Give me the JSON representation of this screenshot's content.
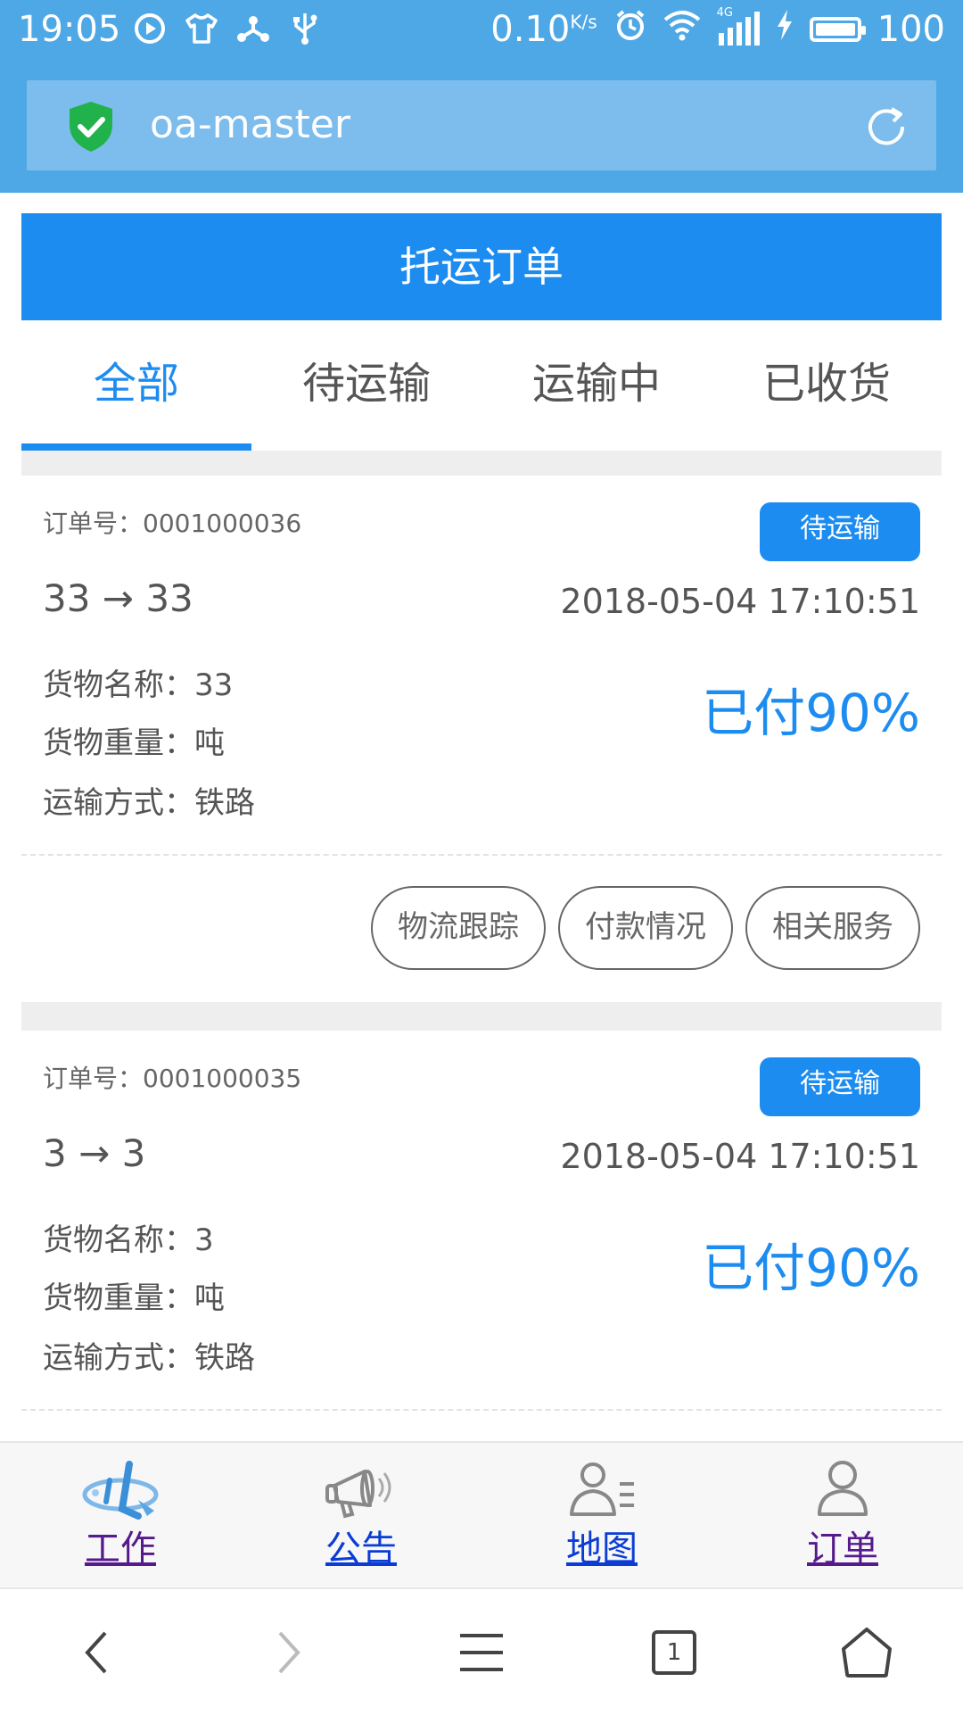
{
  "status_bar": {
    "time": "19:05",
    "speed": "0.10",
    "speed_unit": "K/s",
    "network": "4G",
    "battery": "100"
  },
  "browser": {
    "url": "oa-master",
    "icons": [
      "shield-check-icon",
      "reload-icon"
    ]
  },
  "header": {
    "title": "托运订单"
  },
  "tabs": [
    {
      "label": "全部",
      "active": true
    },
    {
      "label": "待运输",
      "active": false
    },
    {
      "label": "运输中",
      "active": false
    },
    {
      "label": "已收货",
      "active": false
    }
  ],
  "orders": [
    {
      "order_no": "订单号：0001000036",
      "status": "待运输",
      "route": "33 → 33",
      "date": "2018-05-04 17:10:51",
      "goods_name": "货物名称：33",
      "goods_weight": "货物重量：吨",
      "transport": "运输方式：铁路",
      "paid": "已付90%",
      "actions": [
        "物流跟踪",
        "付款情况",
        "相关服务"
      ]
    },
    {
      "order_no": "订单号：0001000035",
      "status": "待运输",
      "route": "3 → 3",
      "date": "2018-05-04 17:10:51",
      "goods_name": "货物名称：3",
      "goods_weight": "货物重量：吨",
      "transport": "运输方式：铁路",
      "paid": "已付90%"
    }
  ],
  "bottom_nav": [
    {
      "label": "工作",
      "icon": "work-logo-icon"
    },
    {
      "label": "公告",
      "icon": "megaphone-icon"
    },
    {
      "label": "地图",
      "icon": "person-list-icon"
    },
    {
      "label": "订单",
      "icon": "user-icon"
    }
  ],
  "browser_nav": {
    "tab_count": "1",
    "icons": [
      "back-icon",
      "forward-icon",
      "menu-icon",
      "tabs-icon",
      "home-icon"
    ]
  },
  "colors": {
    "accent": "#1d8cf0",
    "status_bar": "#4fa8e6",
    "url_bar": "#7cbdee"
  }
}
